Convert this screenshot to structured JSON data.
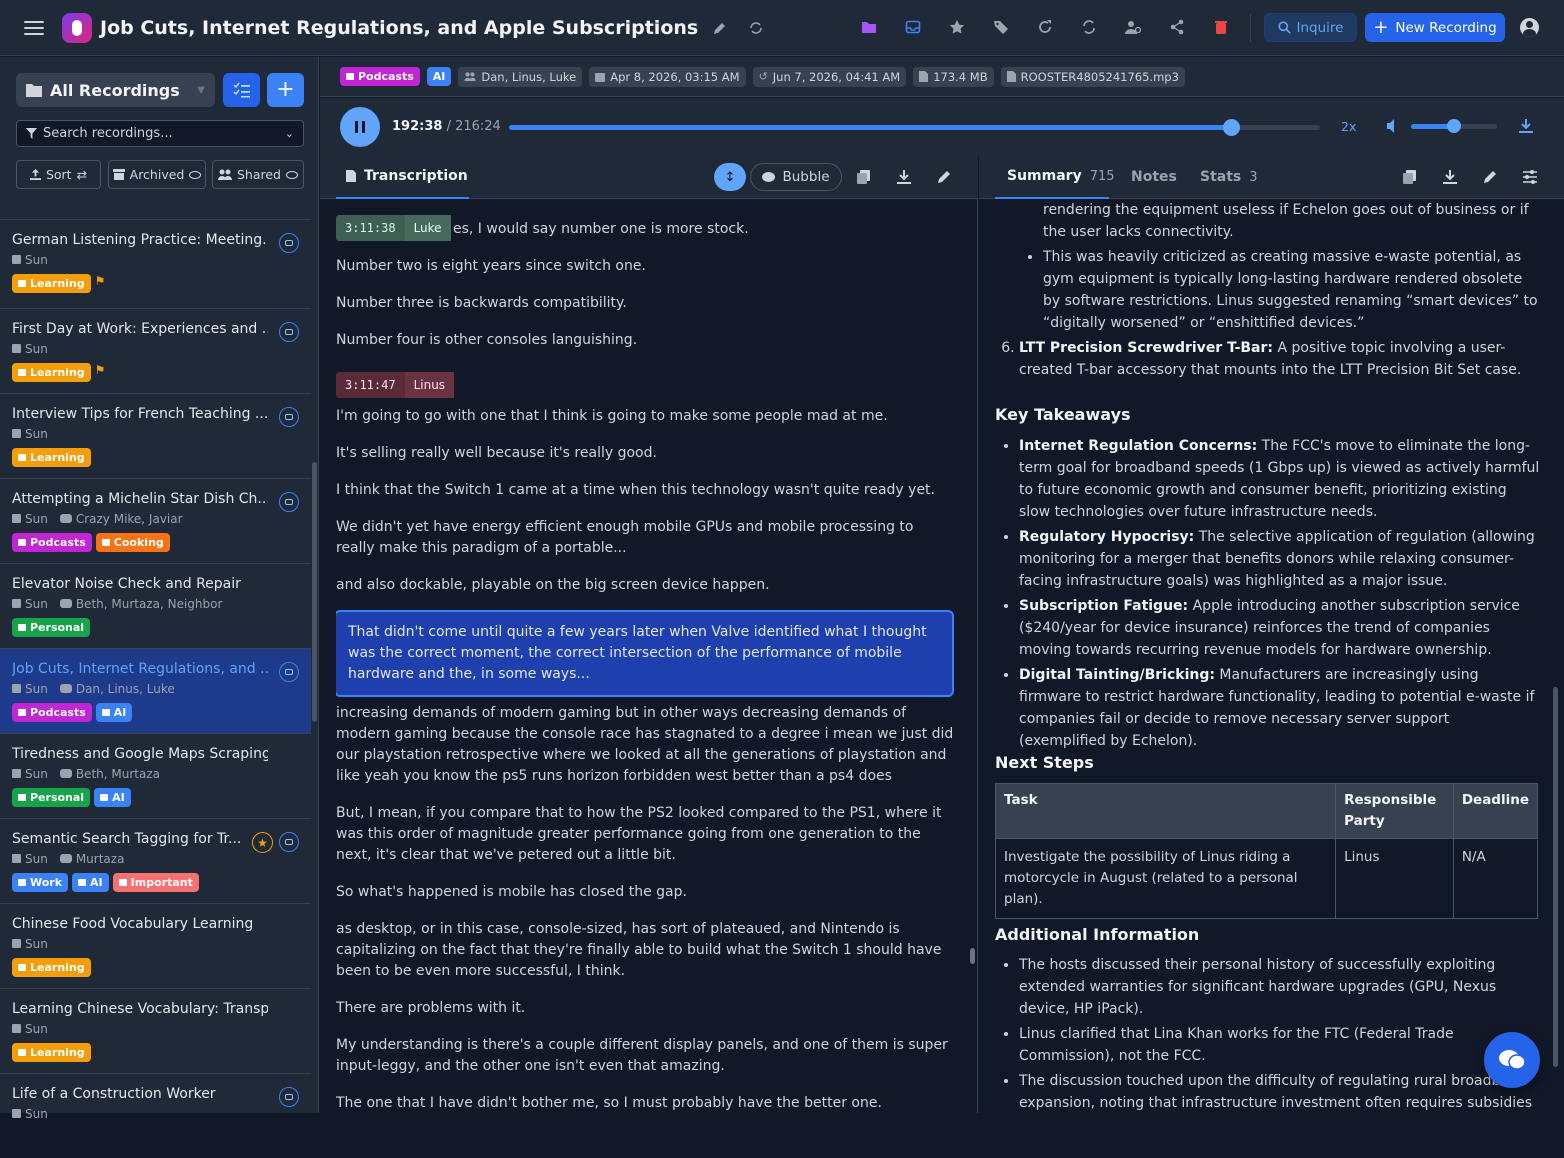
{
  "header": {
    "title": "Job Cuts, Internet Regulations, and Apple Subscriptions",
    "inquire_label": "Inquire",
    "new_recording_label": "New Recording"
  },
  "sidebar": {
    "folder_label": "All Recordings",
    "search_placeholder": "Search recordings...",
    "sort_label": "Sort",
    "archived_label": "Archived",
    "shared_label": "Shared",
    "recordings": [
      {
        "title": "German Listening Practice: Meeting...",
        "date": "Sun",
        "people": "",
        "tags": [
          {
            "label": "Learning",
            "cls": "t-learning"
          }
        ],
        "extra": "⚑",
        "star": false
      },
      {
        "title": "First Day at Work: Experiences and ...",
        "date": "Sun",
        "people": "",
        "tags": [
          {
            "label": "Learning",
            "cls": "t-learning"
          }
        ],
        "extra": "⚑",
        "star": false
      },
      {
        "title": "Interview Tips for French Teaching ...",
        "date": "Sun",
        "people": "",
        "tags": [
          {
            "label": "Learning",
            "cls": "t-learning"
          }
        ],
        "extra": "",
        "star": false
      },
      {
        "title": "Attempting a Michelin Star Dish Ch...",
        "date": "Sun",
        "people": "Crazy Mike, Javiar",
        "tags": [
          {
            "label": "Podcasts",
            "cls": "t-podcasts"
          },
          {
            "label": "Cooking",
            "cls": "t-cooking"
          }
        ],
        "extra": "",
        "star": false
      },
      {
        "title": "Elevator Noise Check and Repair",
        "date": "Sun",
        "people": "Beth, Murtaza, Neighbor",
        "tags": [
          {
            "label": "Personal",
            "cls": "t-personal"
          }
        ],
        "extra": "",
        "star": false,
        "nobadge": true
      },
      {
        "title": "Job Cuts, Internet Regulations, and ...",
        "date": "Sun",
        "people": "Dan, Linus, Luke",
        "tags": [
          {
            "label": "Podcasts",
            "cls": "t-podcasts"
          },
          {
            "label": "AI",
            "cls": "t-ai"
          }
        ],
        "extra": "",
        "star": false,
        "active": true
      },
      {
        "title": "Tiredness and Google Maps Scraping I...",
        "date": "Sun",
        "people": "Beth, Murtaza",
        "tags": [
          {
            "label": "Personal",
            "cls": "t-personal"
          },
          {
            "label": "AI",
            "cls": "t-ai"
          }
        ],
        "extra": "",
        "star": false,
        "nobadge": true
      },
      {
        "title": "Semantic Search Tagging for Tr...",
        "date": "Sun",
        "people": "Murtaza",
        "tags": [
          {
            "label": "Work",
            "cls": "t-work"
          },
          {
            "label": "AI",
            "cls": "t-ai"
          },
          {
            "label": "Important",
            "cls": "t-important"
          }
        ],
        "extra": "",
        "star": true
      },
      {
        "title": "Chinese Food Vocabulary Learning",
        "date": "Sun",
        "people": "",
        "tags": [
          {
            "label": "Learning",
            "cls": "t-learning"
          }
        ],
        "extra": "",
        "star": false,
        "nobadge": true
      },
      {
        "title": "Learning Chinese Vocabulary: Transpor...",
        "date": "Sun",
        "people": "",
        "tags": [
          {
            "label": "Learning",
            "cls": "t-learning"
          }
        ],
        "extra": "",
        "star": false,
        "nobadge": true
      },
      {
        "title": "Life of a Construction Worker",
        "date": "Sun",
        "people": "",
        "tags": [],
        "extra": "",
        "star": false
      }
    ]
  },
  "meta": {
    "tags": [
      {
        "label": "Podcasts",
        "color": "#c026d3"
      },
      {
        "label": "AI",
        "color": "#3b82f6"
      }
    ],
    "participants": "Dan, Linus, Luke",
    "created": "Apr 8, 2026, 03:15 AM",
    "modified": "Jun 7, 2026, 04:41 AM",
    "size": "173.4 MB",
    "filename": "ROOSTER4805241765.mp3"
  },
  "player": {
    "current": "192:38",
    "total": "/ 216:24",
    "progress": 0.89,
    "speed": "2x",
    "volume": 0.5
  },
  "transcript": {
    "tab_label": "Transcription",
    "bubble_label": "Bubble",
    "badge1": {
      "time": "3:11:38",
      "speaker": "Luke"
    },
    "badge2": {
      "time": "3:11:47",
      "speaker": "Linus"
    },
    "lines": [
      "es, I would say number one is more stock.",
      "Number two is eight years since switch one.",
      "Number three is backwards compatibility.",
      "Number four is other consoles languishing.",
      "I'm going to go with one that I think is going to make some people mad at me.",
      "It's selling really well because it's really good.",
      "I think that the Switch 1 came at a time when this technology wasn't quite ready yet.",
      "We didn't yet have energy efficient enough mobile GPUs and mobile processing to really make this paradigm of a portable...",
      "and also dockable, playable on the big screen device happen.",
      "That didn't come until quite a few years later when Valve identified what I thought was the correct moment, the correct intersection of the performance of mobile hardware and the, in some ways...",
      "increasing demands of modern gaming but in other ways decreasing demands of modern gaming because the console race has stagnated to a degree i mean we just did our playstation retrospective where we looked at all the generations of playstation and like yeah you know the ps5 runs horizon forbidden west better than a ps4 does",
      "But, I mean, if you compare that to how the PS2 looked compared to the PS1, where it was this order of magnitude greater performance going from one generation to the next, it's clear that we've petered out a little bit.",
      "So what's happened is mobile has closed the gap.",
      "as desktop, or in this case, console-sized, has sort of plateaued, and Nintendo is capitalizing on the fact that they're finally able to build what the Switch 1 should have been to be even more successful, I think.",
      "There are problems with it.",
      "My understanding is there's a couple different display panels, and one of them is super input-leggy, and the other one isn't even that amazing.",
      "The one that I have didn't bother me, so I must probably have the better one."
    ]
  },
  "summary": {
    "tabs": {
      "summary": "Summary",
      "summary_count": "715",
      "notes": "Notes",
      "stats": "Stats",
      "stats_count": "3"
    },
    "top_cont": "rendering the equipment useless if Echelon goes out of business or if the user lacks connectivity.",
    "top_bullet": "This was heavily criticized as creating massive e-waste potential, as gym equipment is typically long-lasting hardware rendered obsolete by software restrictions. Linus suggested renaming “smart devices” to “digitally worsened” or “enshittified devices.”",
    "item6_label": "LTT Precision Screwdriver T-Bar:",
    "item6_text": " A positive topic involving a user-created T-bar accessory that mounts into the LTT Precision Bit Set case.",
    "key_title": "Key Takeaways",
    "takeaways": [
      {
        "label": "Internet Regulation Concerns:",
        "text": " The FCC's move to eliminate the long-term goal for broadband speeds (1 Gbps up) is viewed as actively harmful to future economic growth and consumer benefit, prioritizing existing slow technologies over future infrastructure needs."
      },
      {
        "label": "Regulatory Hypocrisy:",
        "text": " The selective application of regulation (allowing monitoring for a merger that benefits donors while relaxing consumer-facing infrastructure goals) was highlighted as a major issue."
      },
      {
        "label": "Subscription Fatigue:",
        "text": " Apple introducing another subscription service ($240/year for device insurance) reinforces the trend of companies moving towards recurring revenue models for hardware ownership."
      },
      {
        "label": "Digital Tainting/Bricking:",
        "text": " Manufacturers are increasingly using firmware to restrict hardware functionality, leading to potential e-waste if companies fail or decide to remove necessary server support (exemplified by Echelon)."
      }
    ],
    "next_title": "Next Steps",
    "table_headers": [
      "Task",
      "Responsible Party",
      "Deadline"
    ],
    "table_rows": [
      [
        "Investigate the possibility of Linus riding a motorcycle in August (related to a personal plan).",
        "Linus",
        "N/A"
      ]
    ],
    "additional_title": "Additional Information",
    "additional": [
      "The hosts discussed their personal history of successfully exploiting extended warranties for significant hardware upgrades (GPU, Nexus device, HP iPack).",
      "Linus clarified that Lina Khan works for the FTC (Federal Trade Commission), not the FCC.",
      "The discussion touched upon the difficulty of regulating rural broadband expansion, noting that infrastructure investment often requires subsidies"
    ]
  }
}
